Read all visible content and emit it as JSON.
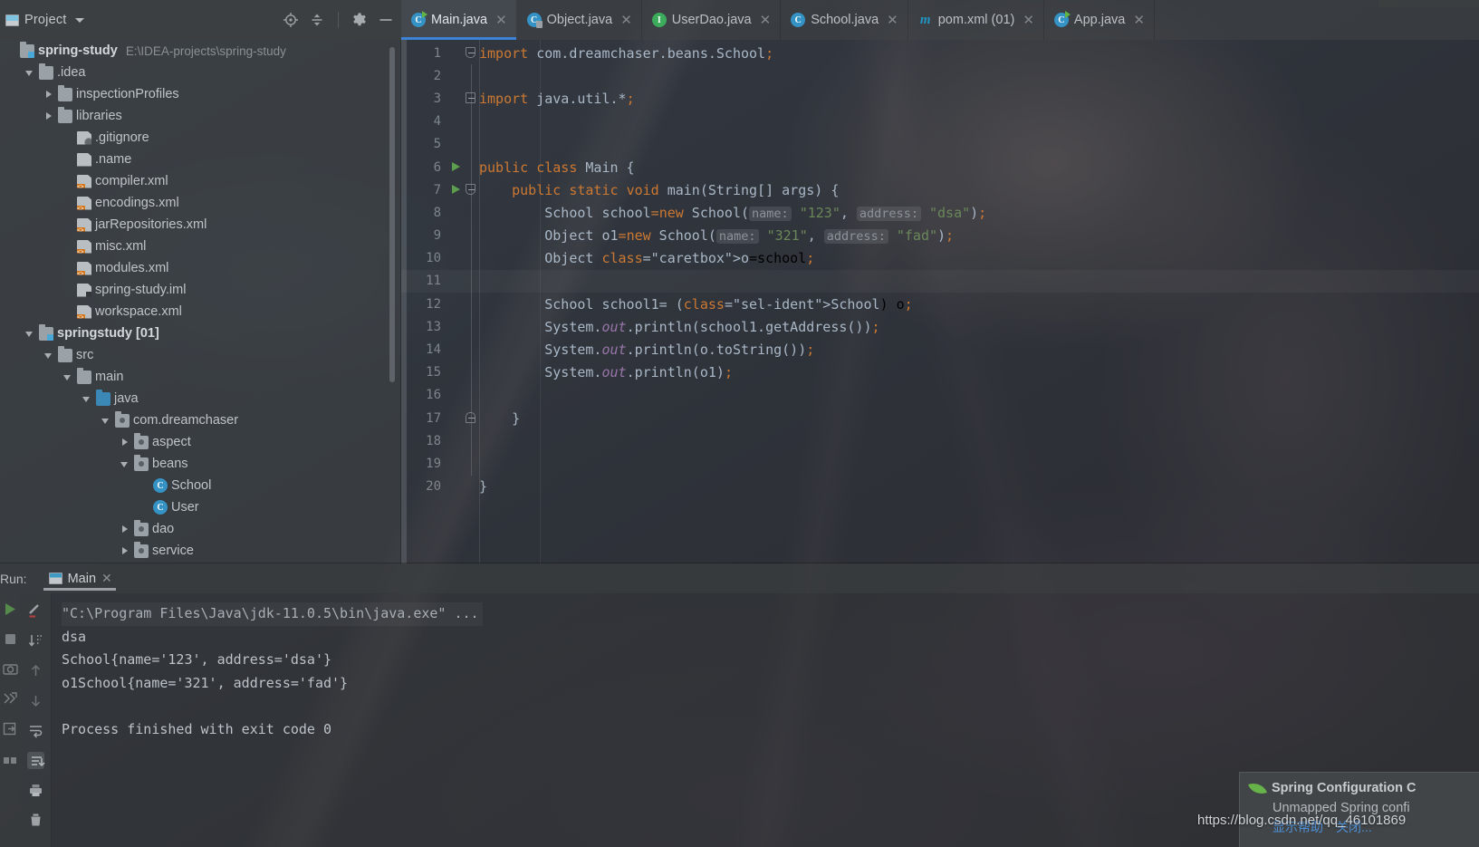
{
  "window": {
    "project_panel_title": "Project",
    "header_icons": [
      "locate-target-icon",
      "collapse-all-icon",
      "gear-icon",
      "minimize-icon"
    ]
  },
  "tabs": [
    {
      "label": "Main.java",
      "icon": "java-class-runnable-icon",
      "active": true,
      "closable": true
    },
    {
      "label": "Object.java",
      "icon": "java-class-locked-icon",
      "active": false,
      "closable": true
    },
    {
      "label": "UserDao.java",
      "icon": "java-interface-icon",
      "active": false,
      "closable": true
    },
    {
      "label": "School.java",
      "icon": "java-class-icon",
      "active": false,
      "closable": true
    },
    {
      "label": "pom.xml (01)",
      "icon": "maven-icon",
      "active": false,
      "closable": true
    },
    {
      "label": "App.java",
      "icon": "java-class-runnable-icon",
      "active": false,
      "closable": true
    }
  ],
  "tree": {
    "root": {
      "name": "spring-study",
      "path": "E:\\IDEA-projects\\spring-study"
    },
    "items": [
      {
        "label": ".idea",
        "indent": 1,
        "arrow": "open",
        "icon": "folder"
      },
      {
        "label": "inspectionProfiles",
        "indent": 2,
        "arrow": "closed",
        "icon": "folder"
      },
      {
        "label": "libraries",
        "indent": 2,
        "arrow": "closed",
        "icon": "folder"
      },
      {
        "label": ".gitignore",
        "indent": 3,
        "arrow": "none",
        "icon": "file-git"
      },
      {
        "label": ".name",
        "indent": 3,
        "arrow": "none",
        "icon": "file"
      },
      {
        "label": "compiler.xml",
        "indent": 3,
        "arrow": "none",
        "icon": "file-xml"
      },
      {
        "label": "encodings.xml",
        "indent": 3,
        "arrow": "none",
        "icon": "file-xml"
      },
      {
        "label": "jarRepositories.xml",
        "indent": 3,
        "arrow": "none",
        "icon": "file-xml"
      },
      {
        "label": "misc.xml",
        "indent": 3,
        "arrow": "none",
        "icon": "file-xml"
      },
      {
        "label": "modules.xml",
        "indent": 3,
        "arrow": "none",
        "icon": "file-xml"
      },
      {
        "label": "spring-study.iml",
        "indent": 3,
        "arrow": "none",
        "icon": "file-iml"
      },
      {
        "label": "workspace.xml",
        "indent": 3,
        "arrow": "none",
        "icon": "file-xml"
      },
      {
        "label": "springstudy [01]",
        "indent": 1,
        "arrow": "open",
        "icon": "folder-module",
        "bold": true
      },
      {
        "label": "src",
        "indent": 2,
        "arrow": "open",
        "icon": "folder"
      },
      {
        "label": "main",
        "indent": 3,
        "arrow": "open",
        "icon": "folder"
      },
      {
        "label": "java",
        "indent": 4,
        "arrow": "open",
        "icon": "folder-source"
      },
      {
        "label": "com.dreamchaser",
        "indent": 5,
        "arrow": "open",
        "icon": "folder-package"
      },
      {
        "label": "aspect",
        "indent": 6,
        "arrow": "closed",
        "icon": "folder-package"
      },
      {
        "label": "beans",
        "indent": 6,
        "arrow": "open",
        "icon": "folder-package"
      },
      {
        "label": "School",
        "indent": 7,
        "arrow": "none",
        "icon": "java-class-icon"
      },
      {
        "label": "User",
        "indent": 7,
        "arrow": "none",
        "icon": "java-class-icon"
      },
      {
        "label": "dao",
        "indent": 6,
        "arrow": "closed",
        "icon": "folder-package"
      },
      {
        "label": "service",
        "indent": 6,
        "arrow": "closed",
        "icon": "folder-package"
      }
    ]
  },
  "editor": {
    "file": "Main.java",
    "first_line": 1,
    "last_line": 20,
    "current_line": 11,
    "lines": [
      {
        "n": 1,
        "gutter": {
          "fold": "top"
        },
        "text": "import com.dreamchaser.beans.School;"
      },
      {
        "n": 2,
        "gutter": {},
        "text": ""
      },
      {
        "n": 3,
        "gutter": {
          "fold": "single"
        },
        "text": "import java.util.*;"
      },
      {
        "n": 4,
        "gutter": {},
        "text": ""
      },
      {
        "n": 5,
        "gutter": {},
        "text": ""
      },
      {
        "n": 6,
        "gutter": {
          "run": true
        },
        "text": "public class Main {"
      },
      {
        "n": 7,
        "gutter": {
          "run": true,
          "fold": "top"
        },
        "text": "    public static void main(String[] args) {"
      },
      {
        "n": 8,
        "gutter": {},
        "text": "        School school=new School( name: \"123\", address: \"dsa\");"
      },
      {
        "n": 9,
        "gutter": {},
        "text": "        Object o1=new School( name: \"321\", address: \"fad\");"
      },
      {
        "n": 10,
        "gutter": {},
        "text": "        Object o=school;"
      },
      {
        "n": 11,
        "gutter": {},
        "text": ""
      },
      {
        "n": 12,
        "gutter": {},
        "text": "        School school1= (School) o;"
      },
      {
        "n": 13,
        "gutter": {},
        "text": "        System.out.println(school1.getAddress());"
      },
      {
        "n": 14,
        "gutter": {},
        "text": "        System.out.println(o.toString());"
      },
      {
        "n": 15,
        "gutter": {},
        "text": "        System.out.println(o1);"
      },
      {
        "n": 16,
        "gutter": {},
        "text": ""
      },
      {
        "n": 17,
        "gutter": {
          "fold": "bottom"
        },
        "text": "    }"
      },
      {
        "n": 18,
        "gutter": {},
        "text": ""
      },
      {
        "n": 19,
        "gutter": {},
        "text": ""
      },
      {
        "n": 20,
        "gutter": {},
        "text": "}"
      }
    ]
  },
  "run": {
    "panel_label": "Run:",
    "tab_label": "Main",
    "tab_close": "×",
    "toolbar_left": [
      "run-icon",
      "stop-icon",
      "camera-icon",
      "rerun-failed-icon",
      "export-icon",
      "layout-icon"
    ],
    "toolbar_right": [
      "soft-wrap-icon",
      "sort-icon",
      "scroll-up-icon",
      "scroll-down-icon",
      "wrap-text-icon",
      "scroll-to-end-icon",
      "print-icon",
      "trash-icon"
    ],
    "console": [
      "\"C:\\Program Files\\Java\\jdk-11.0.5\\bin\\java.exe\" ...",
      "dsa",
      "School{name='123', address='dsa'}",
      "o1School{name='321', address='fad'}",
      "",
      "Process finished with exit code 0"
    ]
  },
  "notification": {
    "icon": "spring-leaf-icon",
    "title": "Spring Configuration C",
    "body": "Unmapped Spring confi",
    "links": [
      "显示帮助",
      "关闭..."
    ]
  },
  "watermark": {
    "text": "https://blog.csdn.net/qq_46101869"
  },
  "colors": {
    "accent_blue": "#3c83d6",
    "keyword_orange": "#cc7832",
    "string_green": "#6a8759",
    "field_purple": "#9876aa",
    "text_gray": "#a9b7c6",
    "run_green": "#5d9e4e",
    "xml_orange": "#d4761a"
  }
}
